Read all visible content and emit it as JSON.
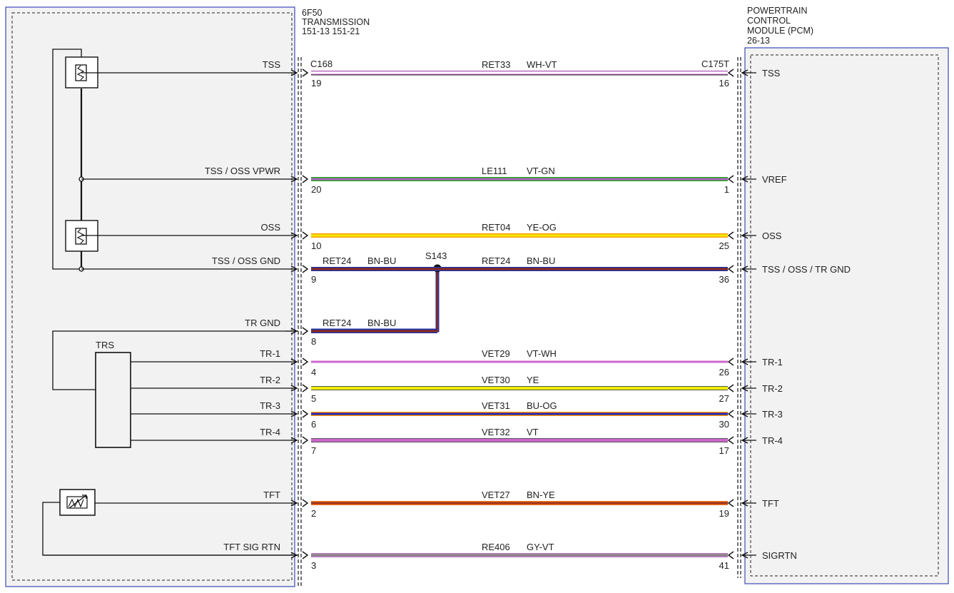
{
  "transmission": {
    "title_line1": "6F50",
    "title_line2": "TRANSMISSION",
    "title_line3": "151-13  151-21"
  },
  "pcm": {
    "title_line1": "POWERTRAIN",
    "title_line2": "CONTROL",
    "title_line3": "MODULE (PCM)",
    "title_line4": "26-13"
  },
  "connectors": {
    "left": "C168",
    "right": "C175T"
  },
  "splice": {
    "label": "S143"
  },
  "trs_label": "TRS",
  "circuits": [
    {
      "id": "tss",
      "left_label": "TSS",
      "left_pin": "19",
      "circuit": "RET33",
      "color_code": "WH-VT",
      "right_pin": "16",
      "right_label": "TSS",
      "colors": [
        "#ffffff",
        "#cc66cc"
      ]
    },
    {
      "id": "vpwr",
      "left_label": "TSS / OSS VPWR",
      "left_pin": "20",
      "circuit": "LE111",
      "color_code": "VT-GN",
      "right_pin": "1",
      "right_label": "VREF",
      "colors": [
        "#b060c0",
        "#22aa22"
      ]
    },
    {
      "id": "oss",
      "left_label": "OSS",
      "left_pin": "10",
      "circuit": "RET04",
      "color_code": "YE-OG",
      "right_pin": "25",
      "right_label": "OSS",
      "colors": [
        "#eeee00",
        "#ff9900"
      ]
    },
    {
      "id": "gnd",
      "left_label": "TSS / OSS GND",
      "left_pin": "9",
      "circuit": "RET24",
      "color_code": "BN-BU",
      "right_pin": "36",
      "right_label": "TSS / OSS / TR GND",
      "colors": [
        "#8b2a1a",
        "#2233aa"
      ]
    },
    {
      "id": "trgnd",
      "left_label": "TR GND",
      "left_pin": "8",
      "circuit": "RET24",
      "color_code": "BN-BU",
      "right_pin": "",
      "right_label": "",
      "colors": [
        "#8b2a1a",
        "#2233aa"
      ]
    },
    {
      "id": "tr1",
      "left_label": "TR-1",
      "left_pin": "4",
      "circuit": "VET29",
      "color_code": "VT-WH",
      "right_pin": "26",
      "right_label": "TR-1",
      "colors": [
        "#cc66cc",
        "#ffffff"
      ]
    },
    {
      "id": "tr2",
      "left_label": "TR-2",
      "left_pin": "5",
      "circuit": "VET30",
      "color_code": "YE",
      "right_pin": "27",
      "right_label": "TR-2",
      "colors": [
        "#eeee00"
      ]
    },
    {
      "id": "tr3",
      "left_label": "TR-3",
      "left_pin": "6",
      "circuit": "VET31",
      "color_code": "BU-OG",
      "right_pin": "30",
      "right_label": "TR-3",
      "colors": [
        "#2222bb",
        "#ff9900"
      ]
    },
    {
      "id": "tr4",
      "left_label": "TR-4",
      "left_pin": "7",
      "circuit": "VET32",
      "color_code": "VT",
      "right_pin": "17",
      "right_label": "TR-4",
      "colors": [
        "#cc66cc"
      ]
    },
    {
      "id": "tft",
      "left_label": "TFT",
      "left_pin": "2",
      "circuit": "VET27",
      "color_code": "BN-YE",
      "right_pin": "19",
      "right_label": "TFT",
      "colors": [
        "#a0331a",
        "#ee7722"
      ]
    },
    {
      "id": "tftsigrtn",
      "left_label": "TFT SIG RTN",
      "left_pin": "3",
      "circuit": "RE406",
      "color_code": "GY-VT",
      "right_pin": "41",
      "right_label": "SIGRTN",
      "colors": [
        "#888888",
        "#bb77bb"
      ]
    }
  ]
}
